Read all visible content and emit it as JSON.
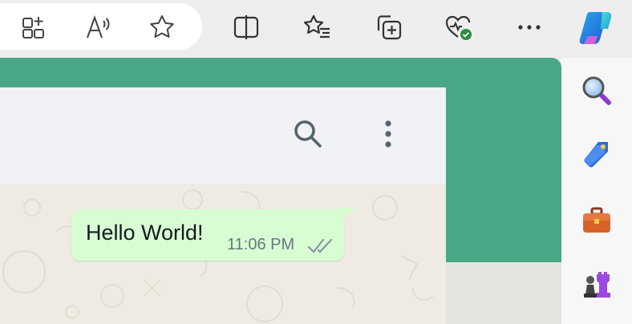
{
  "toolbar": {
    "icons": [
      "add-tab-group-icon",
      "read-aloud-icon",
      "favorite-star-icon",
      "split-screen-icon",
      "favorites-list-icon",
      "collections-icon",
      "browser-essentials-icon",
      "more-icon",
      "copilot-icon"
    ]
  },
  "sidebar": {
    "icons": [
      "search-icon",
      "shopping-icon",
      "tools-icon",
      "games-icon"
    ]
  },
  "chat": {
    "message_text": "Hello World!",
    "message_time": "11:06 PM",
    "status": "read-double-check"
  },
  "colors": {
    "accent_green": "#4aa785",
    "bubble": "#d9fdd3",
    "header": "#f0f2f5",
    "chat_bg": "#efeae2"
  }
}
